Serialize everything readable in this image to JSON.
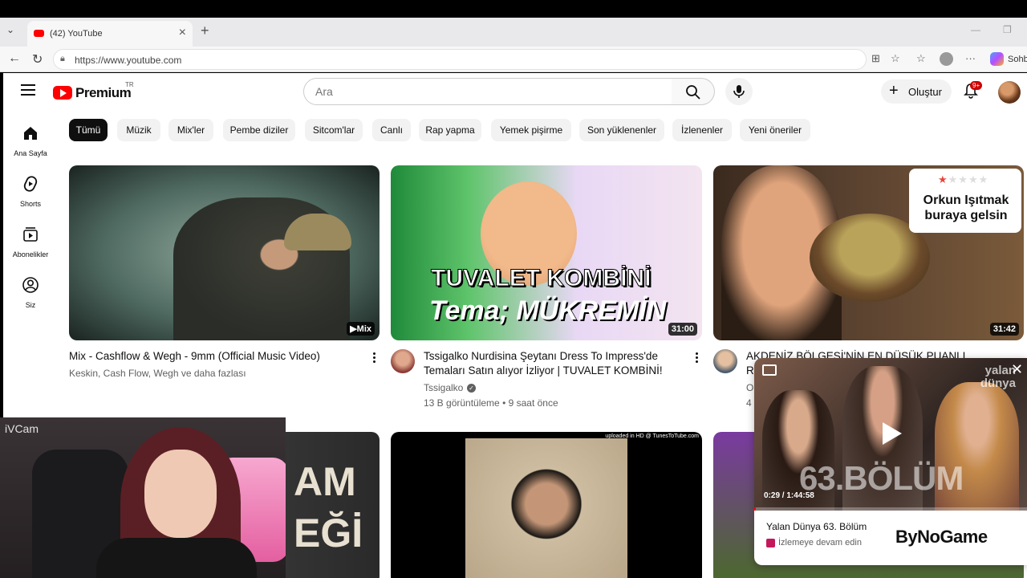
{
  "browser": {
    "tab_title": "(42) YouTube",
    "url": "https://www.youtube.com",
    "side_label": "Sohb"
  },
  "header": {
    "logo_text": "Premium",
    "country_code": "TR",
    "search_placeholder": "Ara",
    "create_label": "Oluştur",
    "notif_badge": "9+"
  },
  "sidebar": [
    {
      "label": "Ana Sayfa",
      "icon": "home-icon"
    },
    {
      "label": "Shorts",
      "icon": "shorts-icon"
    },
    {
      "label": "Abonelikler",
      "icon": "subscriptions-icon"
    },
    {
      "label": "Siz",
      "icon": "you-icon"
    }
  ],
  "chips": [
    "Tümü",
    "Müzik",
    "Mix'ler",
    "Pembe diziler",
    "Sitcom'lar",
    "Canlı",
    "Rap yapma",
    "Yemek pişirme",
    "Son yüklenenler",
    "İzlenenler",
    "Yeni öneriler"
  ],
  "videos": [
    {
      "title": "Mix - Cashflow & Wegh - 9mm (Official Music Video)",
      "channel": "Keskin, Cash Flow, Wegh ve daha fazlası",
      "badge": "Mix"
    },
    {
      "title_line1": "Tssigalko Nurdisina Şeytanı Dress To Impress'de",
      "title_line2": "Temaları Satın alıyor İzliyor | TUVALET KOMBİNİ!",
      "channel": "Tssigalko",
      "stats": "13 B görüntüleme • 9 saat önce",
      "duration": "31:00",
      "thumb_text1": "TUVALET KOMBİNİ",
      "thumb_text2": "Tema; MÜKREMİN"
    },
    {
      "title_partial": "AKDENİZ BÖLGESİ'NİN EN DÜŞÜK PUANLI",
      "line2_partial": "R",
      "channel_partial": "Or",
      "stats_partial": "4",
      "duration": "31:42",
      "thumb_text": "Orkun Işıtmak buraya gelsin"
    }
  ],
  "row2": {
    "thumb1_text": "AM EĞİ",
    "thumb2_caption": "uploaded in HD @ TunesToTube.com"
  },
  "webcam": {
    "label": "iVCam"
  },
  "miniplayer": {
    "title": "Yalan Dünya 63. Bölüm",
    "subtitle": "İzlemeye devam edin",
    "time": "0:29 / 1:44:58",
    "overlay_text": "63.BÖLÜM",
    "logo_text": "yalan dünya",
    "watermark": "ByNoGame"
  }
}
